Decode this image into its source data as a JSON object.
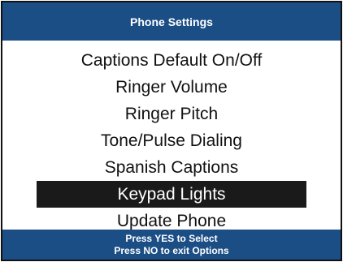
{
  "header": {
    "title": "Phone Settings"
  },
  "menu": {
    "items": [
      {
        "label": "Captions Default On/Off"
      },
      {
        "label": "Ringer Volume"
      },
      {
        "label": "Ringer Pitch"
      },
      {
        "label": "Tone/Pulse Dialing"
      },
      {
        "label": "Spanish Captions"
      },
      {
        "label": "Keypad Lights",
        "selected": true
      },
      {
        "label": "Update Phone"
      }
    ]
  },
  "footer": {
    "line1": "Press YES to Select",
    "line2": "Press NO to exit Options"
  },
  "colors": {
    "bar": "#1c4e86",
    "selected_bg": "#1a1a1a",
    "text": "#111111"
  }
}
